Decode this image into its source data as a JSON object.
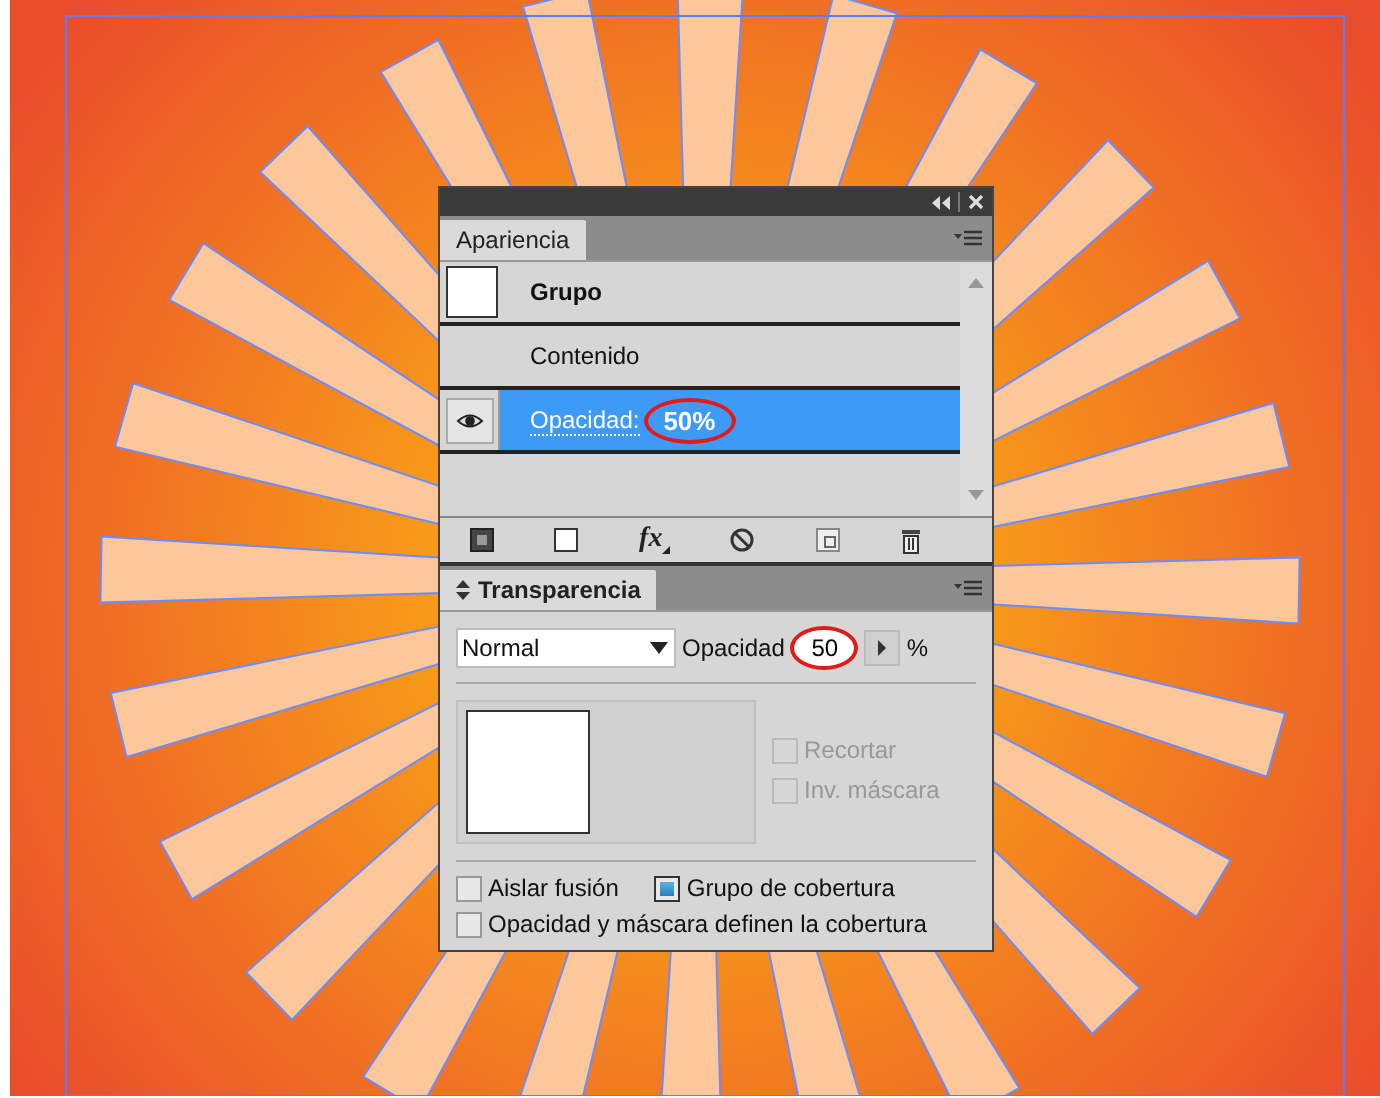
{
  "appearance_panel": {
    "tab": "Apariencia",
    "rows": [
      {
        "kind": "object",
        "label": "Grupo",
        "selected": false
      },
      {
        "kind": "item",
        "label": "Contenido",
        "selected": false
      },
      {
        "kind": "attribute",
        "label": "Opacidad:",
        "value": "50%",
        "selected": true,
        "visible": true
      }
    ],
    "fx_button": "fx"
  },
  "transparency_panel": {
    "tab": "Transparencia",
    "blend_mode": "Normal",
    "opacity_label": "Opacidad",
    "opacity": "50",
    "unit": "%",
    "mask_options": [
      {
        "label": "Recortar",
        "checked": false,
        "disabled": true
      },
      {
        "label": "Inv. máscara",
        "checked": false,
        "disabled": true
      }
    ],
    "options": [
      {
        "label": "Aislar fusión",
        "checked": false
      },
      {
        "label": "Grupo de cobertura",
        "checked": true
      },
      {
        "label": "Opacidad y máscara definen la cobertura",
        "checked": false
      }
    ]
  }
}
